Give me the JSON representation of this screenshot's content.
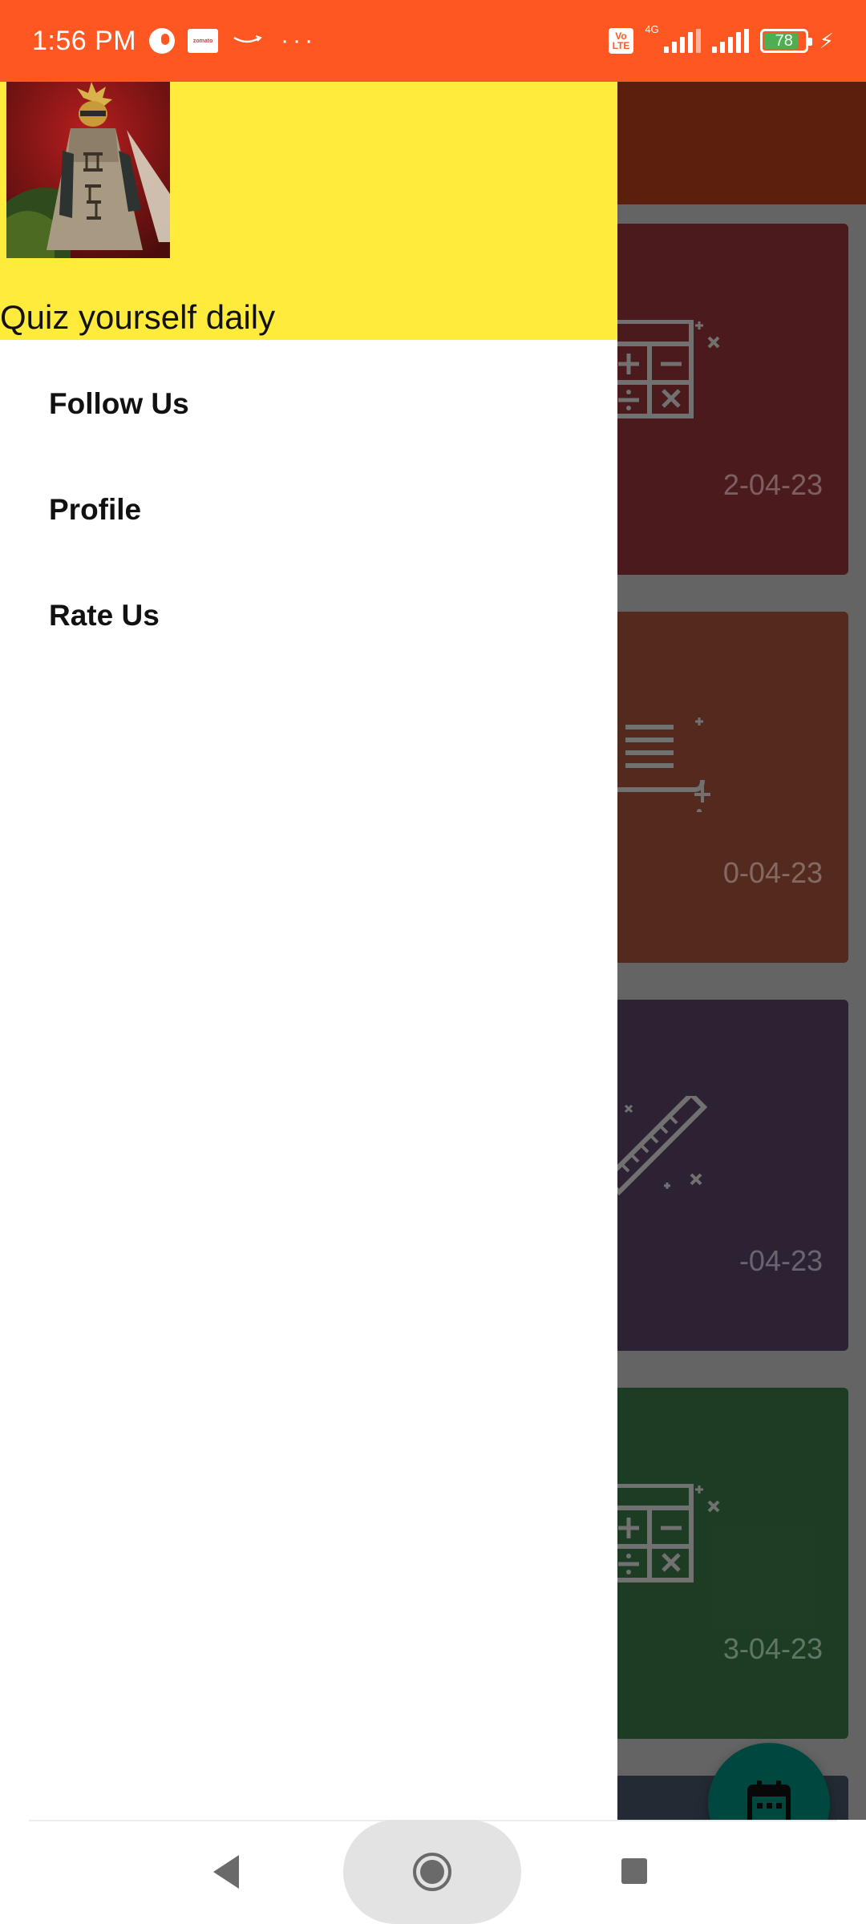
{
  "status_bar": {
    "time": "1:56 PM",
    "network_type": "4G",
    "volte_label": "Vo\nLTE",
    "battery_level": "78",
    "icons": [
      "notification-circle-icon",
      "zomato-icon",
      "amazon-icon",
      "more-dots-icon",
      "volte-icon",
      "signal-icon",
      "signal-icon",
      "battery-icon",
      "charging-bolt-icon"
    ],
    "zomato_label": "zomato",
    "more_dots": "···",
    "bolt": "⚡"
  },
  "drawer": {
    "header": {
      "tagline": "Quiz yourself daily",
      "background_color": "#ffeb3b",
      "avatar_icon": "profile-avatar-image"
    },
    "menu_items": [
      {
        "label": "Follow Us"
      },
      {
        "label": "Profile"
      },
      {
        "label": "Rate Us"
      }
    ]
  },
  "background_app": {
    "toolbar_color": "#6e2610",
    "cards": [
      {
        "date": "2-04-23",
        "color": "#5c2024",
        "icon": "calculator-icon"
      },
      {
        "date": "0-04-23",
        "color": "#673425",
        "icon": "notes-icon"
      },
      {
        "date": "-04-23",
        "color": "#362a40",
        "icon": "ruler-icon"
      },
      {
        "date": "3-04-23",
        "color": "#234b2c",
        "icon": "calculator-icon"
      }
    ],
    "fab_icon": "calendar-icon",
    "fab_color": "#00574f"
  },
  "nav_bar": {
    "icons": [
      "back-icon",
      "home-icon",
      "recents-icon"
    ]
  }
}
